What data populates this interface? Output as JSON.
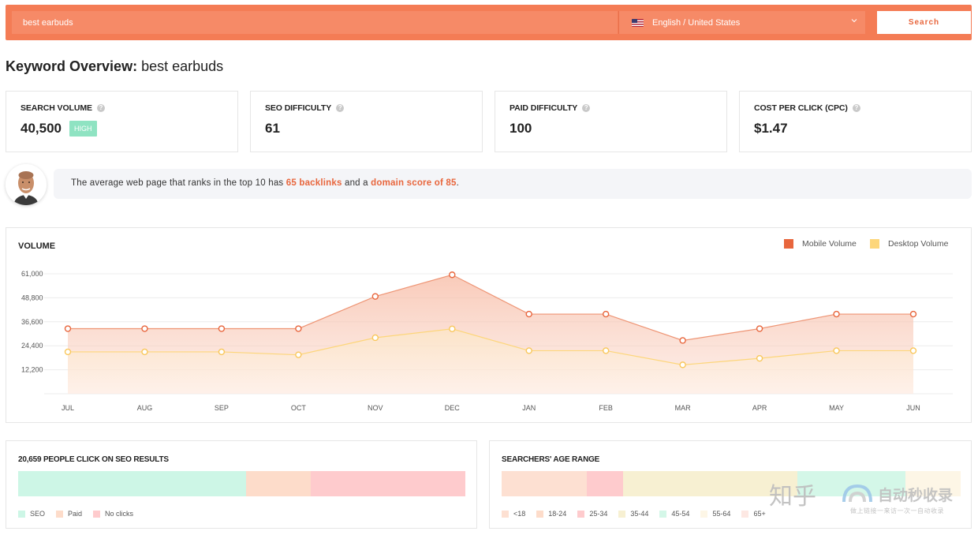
{
  "search": {
    "query": "best earbuds",
    "language": "English / United States",
    "button_label": "Search"
  },
  "title": {
    "prefix": "Keyword Overview:",
    "keyword": "best earbuds"
  },
  "metrics": [
    {
      "label": "SEARCH VOLUME",
      "value": "40,500",
      "badge": "HIGH"
    },
    {
      "label": "SEO DIFFICULTY",
      "value": "61"
    },
    {
      "label": "PAID DIFFICULTY",
      "value": "100"
    },
    {
      "label": "COST PER CLICK (CPC)",
      "value": "$1.47"
    }
  ],
  "tip": {
    "part1": "The average web page that ranks in the top 10 has ",
    "backlinks": "65 backlinks",
    "part2": " and a ",
    "domain_score": "domain score of 85",
    "part3": "."
  },
  "volume_chart": {
    "title": "VOLUME",
    "legend": [
      {
        "label": "Mobile Volume",
        "color": "#e8663d"
      },
      {
        "label": "Desktop Volume",
        "color": "#fdd67a"
      }
    ]
  },
  "chart_data": {
    "type": "area",
    "title": "VOLUME",
    "categories": [
      "JUL",
      "AUG",
      "SEP",
      "OCT",
      "NOV",
      "DEC",
      "JAN",
      "FEB",
      "MAR",
      "APR",
      "MAY",
      "JUN"
    ],
    "yticks": [
      "61,000",
      "48,800",
      "36,600",
      "24,400",
      "12,200"
    ],
    "ytick_values": [
      61000,
      48800,
      36600,
      24400,
      12200
    ],
    "ylim": [
      0,
      61000
    ],
    "grid": true,
    "legend_position": "top-right",
    "series": [
      {
        "name": "Mobile Volume",
        "color": "#e8663d",
        "values": [
          33100,
          33100,
          33100,
          33100,
          49500,
          60500,
          40500,
          40500,
          27100,
          33100,
          40500,
          40500
        ]
      },
      {
        "name": "Desktop Volume",
        "color": "#fdd67a",
        "values": [
          21300,
          21300,
          21300,
          19800,
          28500,
          33000,
          21900,
          21900,
          14700,
          18000,
          21900,
          21900
        ]
      }
    ]
  },
  "seo_clicks": {
    "title": "20,659 PEOPLE CLICK ON SEO RESULTS",
    "segments": [
      {
        "label": "SEO",
        "color": "#cdf6e6",
        "share": 0.51
      },
      {
        "label": "Paid",
        "color": "#fddcca",
        "share": 0.145
      },
      {
        "label": "No clicks",
        "color": "#fecbcd",
        "share": 0.345
      }
    ]
  },
  "age_range": {
    "title": "SEARCHERS' AGE RANGE",
    "segments": [
      {
        "label": "<18",
        "color": "#fde0d2",
        "share": 0.185
      },
      {
        "label": "18-24",
        "color": "#fddcca",
        "share": 0.0
      },
      {
        "label": "25-34",
        "color": "#fecbcd",
        "share": 0.08
      },
      {
        "label": "35-44",
        "color": "#f7f0d2",
        "share": 0.38
      },
      {
        "label": "45-54",
        "color": "#d4f7e8",
        "share": 0.235
      },
      {
        "label": "55-64",
        "color": "#fdf6e6",
        "share": 0.12
      },
      {
        "label": "65+",
        "color": "#fde8e3",
        "share": 0.0
      }
    ]
  },
  "watermark": {
    "zh": "知乎",
    "brand": "自动秒收录",
    "slogan": "做上链接一来访一次一自动收录"
  }
}
